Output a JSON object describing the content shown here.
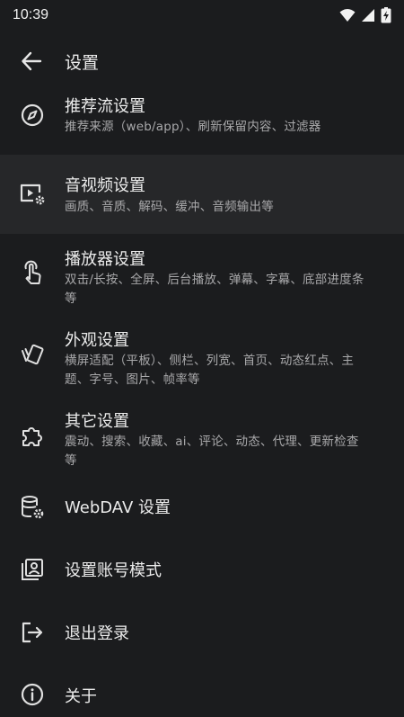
{
  "status_bar": {
    "time": "10:39"
  },
  "app_bar": {
    "title": "设置"
  },
  "items": [
    {
      "title": "推荐流设置",
      "subtitle": "推荐来源（web/app）、刷新保留内容、过滤器",
      "icon": "compass-icon"
    },
    {
      "title": "音视频设置",
      "subtitle": "画质、音质、解码、缓冲、音频输出等",
      "icon": "video-settings-icon"
    },
    {
      "title": "播放器设置",
      "subtitle": "双击/长按、全屏、后台播放、弹幕、字幕、底部进度条等",
      "icon": "touch-icon"
    },
    {
      "title": "外观设置",
      "subtitle": "横屏适配（平板）、侧栏、列宽、首页、动态红点、主题、字号、图片、帧率等",
      "icon": "style-icon"
    },
    {
      "title": "其它设置",
      "subtitle": "震动、搜索、收藏、ai、评论、动态、代理、更新检查等",
      "icon": "extension-icon"
    },
    {
      "title": "WebDAV 设置",
      "icon": "database-settings-icon"
    },
    {
      "title": "设置账号模式",
      "icon": "account-box-icon"
    },
    {
      "title": "退出登录",
      "icon": "logout-icon"
    },
    {
      "title": "关于",
      "icon": "info-icon"
    }
  ]
}
